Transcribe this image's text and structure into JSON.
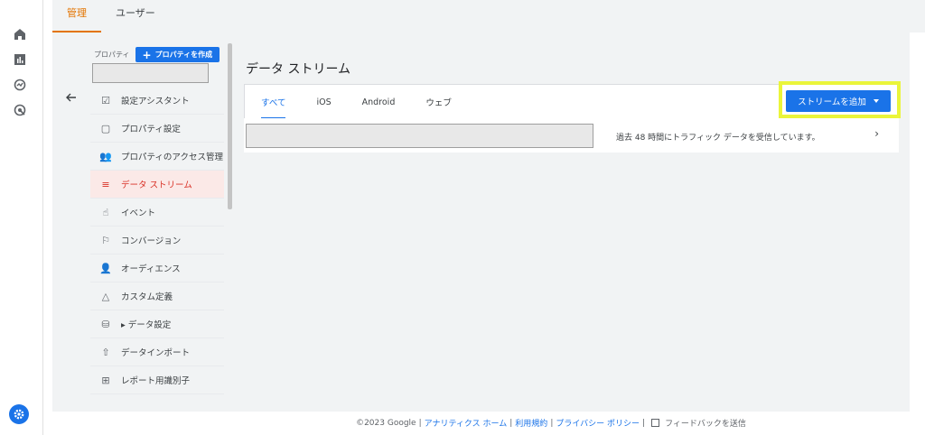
{
  "top_tabs": [
    {
      "label": "管理",
      "active": true
    },
    {
      "label": "ユーザー",
      "active": false
    }
  ],
  "rail_icons": [
    "home-icon",
    "reports-icon",
    "explore-icon",
    "advertising-icon"
  ],
  "property": {
    "label": "プロパティ",
    "create_button": "プロパティを作成",
    "create_icon": "+"
  },
  "nav_items": [
    {
      "label": "設定アシスタント",
      "icon": "checklist-icon",
      "glyph": "☑",
      "active": false
    },
    {
      "label": "プロパティ設定",
      "icon": "window-icon",
      "glyph": "▢",
      "active": false
    },
    {
      "label": "プロパティのアクセス管理",
      "icon": "people-icon",
      "glyph": "👥",
      "active": false
    },
    {
      "label": "データ ストリーム",
      "icon": "streams-icon",
      "glyph": "≡",
      "active": true
    },
    {
      "label": "イベント",
      "icon": "touch-icon",
      "glyph": "☝",
      "active": false
    },
    {
      "label": "コンバージョン",
      "icon": "flag-icon",
      "glyph": "⚐",
      "active": false
    },
    {
      "label": "オーディエンス",
      "icon": "audience-icon",
      "glyph": "👤",
      "active": false
    },
    {
      "label": "カスタム定義",
      "icon": "shapes-icon",
      "glyph": "△",
      "active": false
    },
    {
      "label": "▸ データ設定",
      "icon": "database-icon",
      "glyph": "⛁",
      "active": false
    },
    {
      "label": "データインポート",
      "icon": "upload-icon",
      "glyph": "⇧",
      "active": false
    },
    {
      "label": "レポート用識別子",
      "icon": "identifier-icon",
      "glyph": "⊞",
      "active": false
    }
  ],
  "main": {
    "title": "データ ストリーム",
    "sub_tabs": [
      {
        "label": "すべて",
        "active": true
      },
      {
        "label": "iOS",
        "active": false
      },
      {
        "label": "Android",
        "active": false
      },
      {
        "label": "ウェブ",
        "active": false
      }
    ],
    "add_stream_button": "ストリームを追加",
    "stream": {
      "status": "過去 48 時間にトラフィック データを受信しています。",
      "chevron": "›"
    }
  },
  "footer": {
    "copyright": "©2023 Google",
    "links": [
      "アナリティクス ホーム",
      "利用規約",
      "プライバシー ポリシー"
    ],
    "feedback": "フィードバックを送信"
  },
  "colors": {
    "accent": "#1a73e8",
    "active_nav": "#d93025",
    "active_top_tab": "#e37400",
    "highlight": "#eaf53a"
  }
}
